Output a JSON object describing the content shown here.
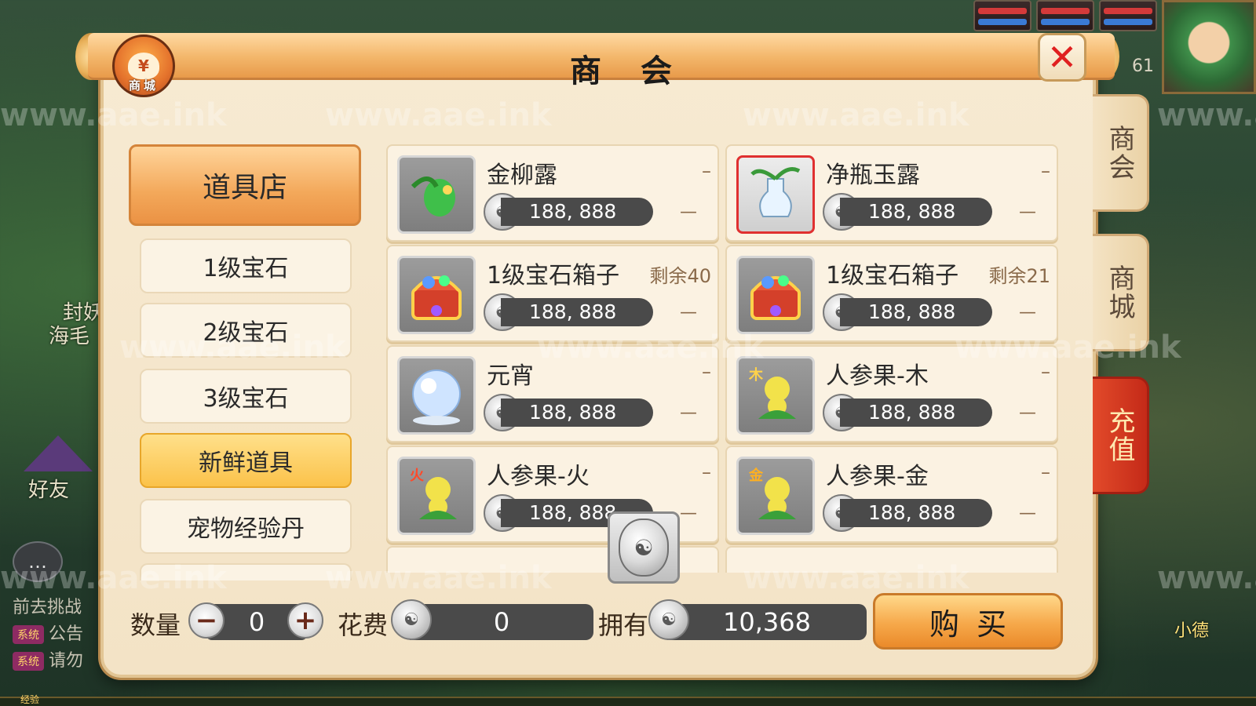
{
  "background": {
    "watermark": "www.aae.ink",
    "left_hud": {
      "label_top": "封妖",
      "label_mid": "海毛",
      "friend": "好友",
      "chat_prompt": "前去挑战",
      "chat_tag": "系统",
      "chat_line1": "公告",
      "chat_line2": "请勿",
      "exp_label": "经验"
    },
    "level": "61",
    "right_name": "小德"
  },
  "dialog": {
    "title": "商 会",
    "shop_badge_label": "商城",
    "shop_badge_glyph": "¥",
    "close_glyph": "✕"
  },
  "side_tabs": [
    {
      "label": "商会"
    },
    {
      "label": "商城"
    },
    {
      "label": "充值"
    }
  ],
  "categories": {
    "main": "道具店",
    "items": [
      {
        "label": "1级宝石"
      },
      {
        "label": "2级宝石"
      },
      {
        "label": "3级宝石"
      },
      {
        "label": "新鲜道具"
      },
      {
        "label": "宠物经验丹"
      }
    ]
  },
  "items": [
    {
      "name": "金柳露",
      "price": "188, 888",
      "stock": "–",
      "trend": "—",
      "icon": "green-seed-icon"
    },
    {
      "name": "净瓶玉露",
      "price": "188, 888",
      "stock": "–",
      "trend": "—",
      "icon": "jade-vase-icon"
    },
    {
      "name": "1级宝石箱子",
      "price": "188, 888",
      "stock": "剩余40",
      "trend": "—",
      "icon": "gem-chest-icon"
    },
    {
      "name": "1级宝石箱子",
      "price": "188, 888",
      "stock": "剩余21",
      "trend": "—",
      "icon": "gem-chest-icon"
    },
    {
      "name": "元宵",
      "price": "188, 888",
      "stock": "–",
      "trend": "—",
      "icon": "pearl-icon"
    },
    {
      "name": "人参果-木",
      "price": "188, 888",
      "stock": "–",
      "trend": "—",
      "icon": "ginseng-wood-icon"
    },
    {
      "name": "人参果-火",
      "price": "188, 888",
      "stock": "–",
      "trend": "—",
      "icon": "ginseng-fire-icon"
    },
    {
      "name": "人参果-金",
      "price": "188, 888",
      "stock": "–",
      "trend": "—",
      "icon": "ginseng-gold-icon"
    }
  ],
  "footer": {
    "quantity_label": "数量",
    "quantity_value": "0",
    "minus_glyph": "−",
    "plus_glyph": "+",
    "cost_label": "花费",
    "cost_value": "0",
    "own_label": "拥有",
    "own_value": "10,368",
    "buy_label": "购买"
  },
  "colors": {
    "accent": "#f3a85a",
    "close_red": "#e02020",
    "recharge_red": "#c42a18",
    "price_bar": "#4a4a4a"
  }
}
